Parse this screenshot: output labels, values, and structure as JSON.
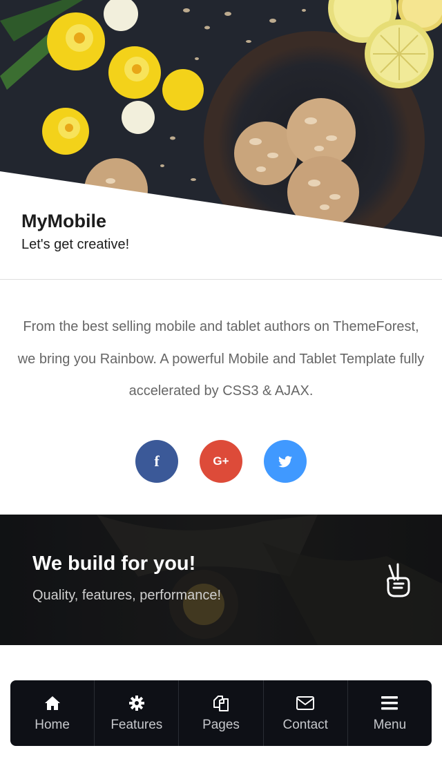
{
  "hero": {
    "title": "MyMobile",
    "subtitle": "Let's get creative!"
  },
  "description": "From the best selling mobile and tablet authors on ThemeForest, we bring you Rainbow. A powerful Mobile and Tablet Template fully accelerated by CSS3 & AJAX.",
  "social": {
    "facebook": "f",
    "google_plus": "G+",
    "twitter_icon": "twitter-icon",
    "colors": {
      "facebook": "#3b5998",
      "google_plus": "#dd4b39",
      "twitter": "#4099ff"
    }
  },
  "banner": {
    "title": "We build for you!",
    "subtitle": "Quality, features, performance!",
    "icon": "peace-hand-icon"
  },
  "nav": {
    "items": [
      {
        "label": "Home",
        "icon": "home-icon"
      },
      {
        "label": "Features",
        "icon": "gear-icon"
      },
      {
        "label": "Pages",
        "icon": "pages-icon"
      },
      {
        "label": "Contact",
        "icon": "envelope-icon"
      },
      {
        "label": "Menu",
        "icon": "menu-icon"
      }
    ]
  }
}
